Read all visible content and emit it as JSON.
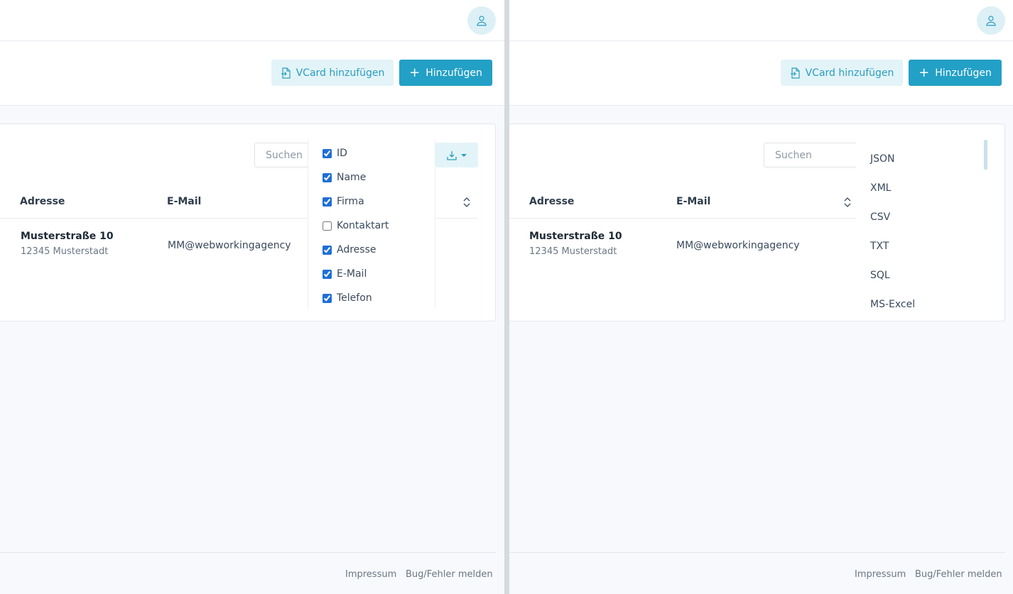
{
  "header": {
    "avatar_icon": "user-icon"
  },
  "actions": {
    "vcard_label": "VCard hinzufügen",
    "add_label": "Hinzufügen",
    "vcard_icon": "file-import-icon",
    "add_icon": "plus-icon"
  },
  "table": {
    "search_placeholder": "Suchen",
    "export_icon": "download-icon",
    "headers": {
      "address": "Adresse",
      "email": "E-Mail"
    },
    "rows": [
      {
        "street": "Musterstraße 10",
        "city": "12345 Musterstadt",
        "email": "MM@webworkingagency"
      }
    ]
  },
  "column_menu": {
    "items": [
      {
        "label": "ID",
        "checked": true
      },
      {
        "label": "Name",
        "checked": true
      },
      {
        "label": "Firma",
        "checked": true
      },
      {
        "label": "Kontaktart",
        "checked": false
      },
      {
        "label": "Adresse",
        "checked": true
      },
      {
        "label": "E-Mail",
        "checked": true
      },
      {
        "label": "Telefon",
        "checked": true
      }
    ]
  },
  "export_menu": {
    "items": [
      "JSON",
      "XML",
      "CSV",
      "TXT",
      "SQL",
      "MS-Excel"
    ]
  },
  "footer": {
    "imprint": "Impressum",
    "bug_report": "Bug/Fehler melden"
  },
  "colors": {
    "accent": "#23a0c6",
    "accent_light": "#e3f4f8",
    "background": "#f7f9fc"
  }
}
